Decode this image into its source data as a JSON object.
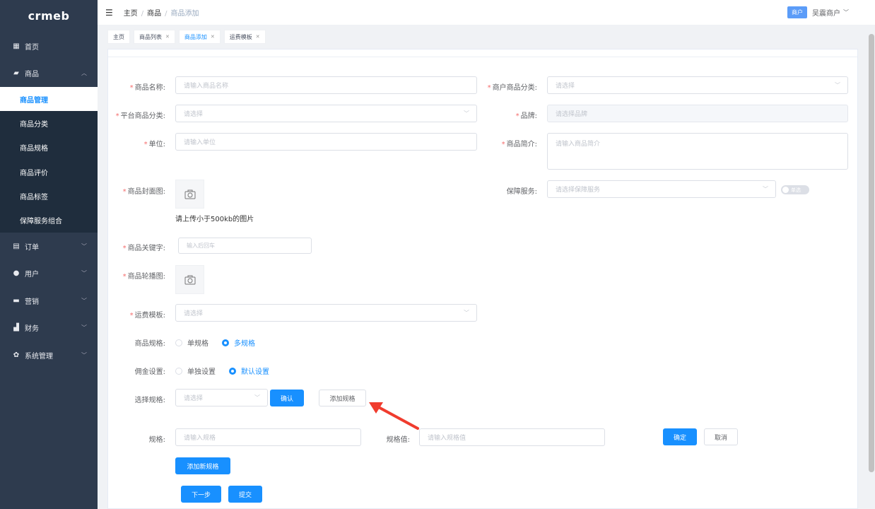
{
  "sidebar": {
    "logo": "crmeb",
    "items": [
      {
        "label": "首页",
        "icon": "grid-icon"
      },
      {
        "label": "商品",
        "icon": "bag-icon"
      },
      {
        "label": "订单",
        "icon": "clipboard-icon"
      },
      {
        "label": "用户",
        "icon": "user-icon"
      },
      {
        "label": "营销",
        "icon": "monitor-icon"
      },
      {
        "label": "财务",
        "icon": "wallet-icon"
      },
      {
        "label": "系统管理",
        "icon": "gear-icon"
      }
    ],
    "sub_items": [
      "商品管理",
      "商品分类",
      "商品规格",
      "商品评价",
      "商品标签",
      "保障服务组合"
    ]
  },
  "header": {
    "breadcrumb": [
      "主页",
      "商品",
      "商品添加"
    ],
    "badge": "商户",
    "merchant": "吴震商户"
  },
  "tabs": [
    {
      "label": "主页",
      "closable": false
    },
    {
      "label": "商品列表",
      "closable": true
    },
    {
      "label": "商品添加",
      "closable": true
    },
    {
      "label": "运费模板",
      "closable": true
    }
  ],
  "form": {
    "name": {
      "label": "商品名称:",
      "placeholder": "请输入商品名称"
    },
    "merchant_cat": {
      "label": "商户商品分类:",
      "placeholder": "请选择"
    },
    "platform_cat": {
      "label": "平台商品分类:",
      "placeholder": "请选择"
    },
    "brand": {
      "label": "品牌:",
      "placeholder": "请选择品牌"
    },
    "unit": {
      "label": "单位:",
      "placeholder": "请输入单位"
    },
    "intro": {
      "label": "商品简介:",
      "placeholder": "请输入商品简介"
    },
    "cover": {
      "label": "商品封面图:",
      "hint": "请上传小于500kb的图片"
    },
    "guarantee": {
      "label": "保障服务:",
      "placeholder": "请选择保障服务",
      "switch_text": "单选"
    },
    "keywords": {
      "label": "商品关键字:",
      "placeholder": "输入后回车"
    },
    "carousel": {
      "label": "商品轮播图:"
    },
    "shipping": {
      "label": "运费模板:",
      "placeholder": "请选择"
    },
    "spec_type": {
      "label": "商品规格:",
      "options": [
        "单规格",
        "多规格"
      ],
      "selected": "多规格"
    },
    "commission": {
      "label": "佣金设置:",
      "options": [
        "单独设置",
        "默认设置"
      ],
      "selected": "默认设置"
    },
    "select_spec": {
      "label": "选择规格:",
      "placeholder": "请选择",
      "confirm": "确认",
      "add": "添加规格"
    },
    "spec_row": {
      "spec_label": "规格:",
      "spec_placeholder": "请输入规格",
      "value_label": "规格值:",
      "value_placeholder": "请输入规格值",
      "ok": "确定",
      "cancel": "取消"
    },
    "add_new_spec": "添加新规格",
    "next": "下一步",
    "submit": "提交"
  },
  "colors": {
    "primary": "#1890ff",
    "sidebar": "#2e3b4e",
    "required": "#f56c6c",
    "annotation_arrow": "#f03c2e"
  }
}
